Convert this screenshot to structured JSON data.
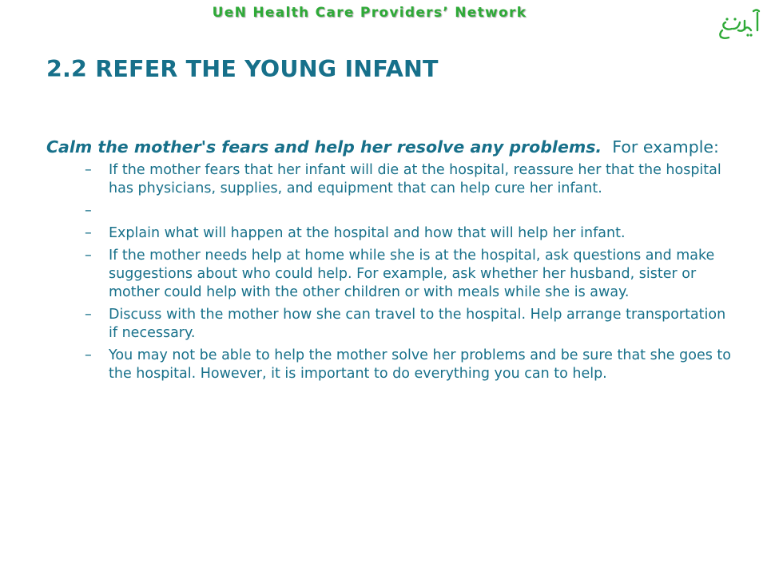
{
  "header": {
    "network_title": "UeN Health Care Providers’ Network",
    "logo_text": "اُمیدِنو",
    "logo_color": "#2eaa37"
  },
  "slide": {
    "title": "2.2 REFER THE YOUNG INFANT",
    "lead_emphasis": "Calm the mother's fears and help her resolve any problems.",
    "lead_rest": "For example:",
    "bullet_marker": "–",
    "bullets": [
      "If the mother fears that her infant will die at the hospital, reassure her that the hospital has physicians, supplies, and equipment that can help cure her infant.",
      "",
      "Explain what will happen at the hospital and how that will help her infant.",
      "If the mother needs help at home while she is at the hospital, ask questions and make suggestions about who could help.  For example, ask whether her husband, sister or mother could help with the other children or with meals while she is away.",
      "Discuss with the mother how she can travel to the hospital.  Help arrange transportation if necessary.",
      "You may not be able to help the mother solve her problems and be sure that she goes to the hospital.  However, it is important to do everything you can to help."
    ]
  },
  "colors": {
    "title": "#17708a",
    "header_green": "#2eaa37",
    "background": "#ffffff"
  }
}
